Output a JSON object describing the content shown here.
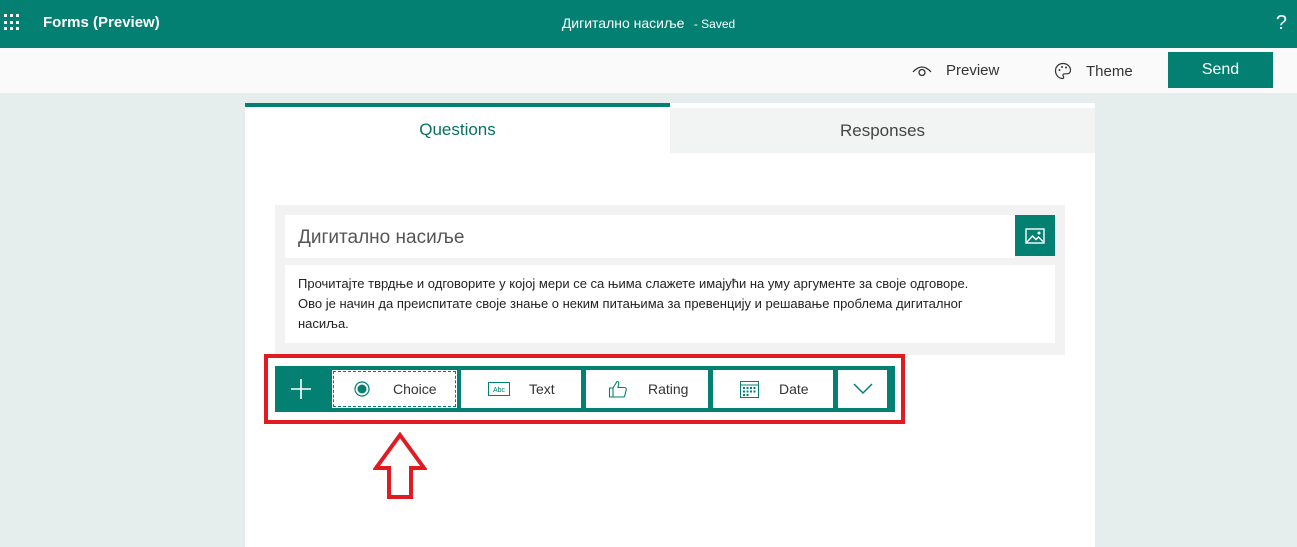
{
  "header": {
    "app_name": "Forms (Preview)",
    "doc_title": "Дигитално насиље",
    "saved_status": "Saved",
    "help": "?"
  },
  "commands": {
    "preview": "Preview",
    "theme": "Theme",
    "send": "Send"
  },
  "tabs": [
    {
      "label": "Questions",
      "active": true
    },
    {
      "label": "Responses",
      "active": false
    }
  ],
  "form": {
    "title": "Дигитално насиље",
    "description_lines": [
      "Прочитајте тврдње и одговорите у којој мери се са њима слажете имајући на уму аргументе за своје одговоре.",
      "Ово је начин да преиспитате своје знање о неким питањима за превенцију и решавање проблема дигиталног",
      "насиља."
    ]
  },
  "question_types": [
    {
      "label": "Choice",
      "icon": "radio-icon"
    },
    {
      "label": "Text",
      "icon": "text-abc-icon"
    },
    {
      "label": "Rating",
      "icon": "thumbs-up-icon"
    },
    {
      "label": "Date",
      "icon": "calendar-icon"
    }
  ],
  "colors": {
    "brand": "#038071",
    "highlight": "#e01b22"
  }
}
